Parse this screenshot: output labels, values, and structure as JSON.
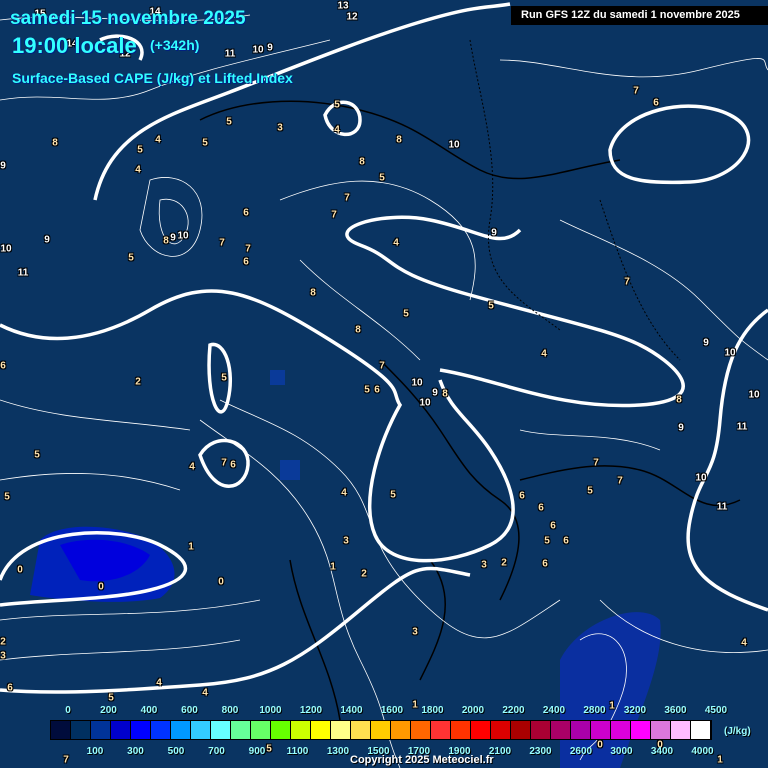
{
  "header": {
    "date": "samedi 15 novembre 2025",
    "time": "19:00 locale",
    "lead": "(+342h)",
    "parameter": "Surface-Based CAPE (J/kg) et Lifted Index",
    "run": "Run GFS 12Z du samedi 1 novembre 2025"
  },
  "legend": {
    "unit": "(J/kg)",
    "top_labels": [
      "0",
      "200",
      "400",
      "600",
      "800",
      "1000",
      "1200",
      "1400",
      "1600",
      "1800",
      "2000",
      "2200",
      "2400",
      "2800",
      "3200",
      "3600",
      "4500"
    ],
    "bottom_labels": [
      "100",
      "300",
      "500",
      "700",
      "900",
      "1100",
      "1300",
      "1500",
      "1700",
      "1900",
      "2100",
      "2300",
      "2600",
      "3000",
      "3400",
      "4000"
    ],
    "colors": [
      "#000c3c",
      "#003060",
      "#003399",
      "#0000cc",
      "#0000ff",
      "#0033ff",
      "#0099ff",
      "#33ccff",
      "#66ffff",
      "#66ff99",
      "#66ff66",
      "#66ff00",
      "#ccff00",
      "#ffff00",
      "#ffff88",
      "#ffe050",
      "#ffcc00",
      "#ff9900",
      "#ff6600",
      "#ff3333",
      "#ff3300",
      "#ff0000",
      "#dd0000",
      "#aa0000",
      "#aa0033",
      "#aa0066",
      "#aa00aa",
      "#cc00cc",
      "#dd00dd",
      "#ff00ff",
      "#dd77dd",
      "#ffbbff",
      "#ffffff"
    ]
  },
  "lifted_index_labels": [
    "15",
    "14",
    "14",
    "12",
    "13",
    "12",
    "11",
    "10",
    "9",
    "5",
    "4",
    "5",
    "3",
    "5",
    "4",
    "5",
    "4",
    "8",
    "9",
    "10",
    "8",
    "8",
    "5",
    "7",
    "6",
    "6",
    "7",
    "7",
    "10",
    "9",
    "8",
    "7",
    "7",
    "6",
    "5",
    "10",
    "9",
    "11",
    "4",
    "9",
    "8",
    "7",
    "5",
    "5",
    "8",
    "4",
    "9",
    "10",
    "6",
    "5",
    "2",
    "7",
    "6",
    "5",
    "10",
    "9",
    "8",
    "10",
    "8",
    "9",
    "10",
    "11",
    "5",
    "4",
    "7",
    "6",
    "4",
    "5",
    "7",
    "7",
    "5",
    "6",
    "6",
    "6",
    "5",
    "6",
    "6",
    "10",
    "11",
    "2",
    "3",
    "1",
    "2",
    "3",
    "1",
    "0",
    "0",
    "0",
    "3",
    "2",
    "3",
    "1",
    "6",
    "4",
    "4",
    "5",
    "4",
    "5",
    "1",
    "1",
    "7",
    "5",
    "0",
    "0"
  ],
  "copyright": "Copyright 2025 Meteociel.fr",
  "colors": {
    "background": "#0a3462",
    "title": "#33ffff"
  }
}
